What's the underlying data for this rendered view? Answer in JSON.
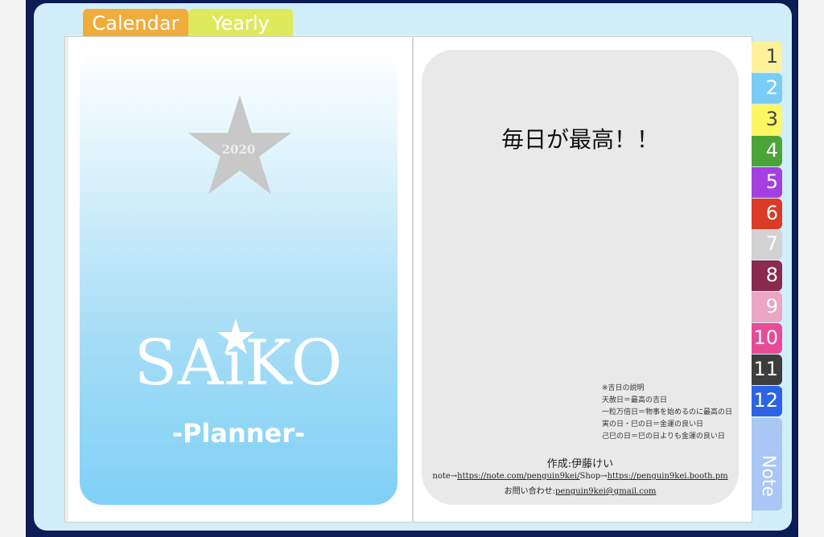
{
  "top_tabs": {
    "calendar": "Calendar",
    "yearly": "Yearly"
  },
  "cover": {
    "year": "2020",
    "logo": "SAiKO",
    "subtitle": "-Planner-"
  },
  "info": {
    "headline": "毎日が最高！！",
    "notes": [
      "※吉日の説明",
      "天赦日＝最高の吉日",
      "一粒万倍日＝物事を始めるのに最高の日",
      "寅の日・巳の日＝金運の良い日",
      "己巳の日＝巳の日よりも金運の良い日"
    ],
    "author": "作成:伊藤けい",
    "note_prefix": "note→",
    "note_url": "https://note.com/penguin9kei/",
    "shop_prefix": "Shop→",
    "shop_url": "https://penguin9kei.booth.pm",
    "contact_prefix": "お問い合わせ:",
    "contact_email": "penguin9kei@gmail.com"
  },
  "month_tabs": [
    {
      "label": "1",
      "color": "#fdf29a",
      "text": "#444"
    },
    {
      "label": "2",
      "color": "#79cdf5",
      "text": "#fff"
    },
    {
      "label": "3",
      "color": "#fdf764",
      "text": "#444"
    },
    {
      "label": "4",
      "color": "#4aa437",
      "text": "#fff"
    },
    {
      "label": "5",
      "color": "#a440e0",
      "text": "#fff"
    },
    {
      "label": "6",
      "color": "#da3a26",
      "text": "#fff"
    },
    {
      "label": "7",
      "color": "#d2d2d2",
      "text": "#fff"
    },
    {
      "label": "8",
      "color": "#8a2a4c",
      "text": "#fff"
    },
    {
      "label": "9",
      "color": "#eaa6c2",
      "text": "#fff"
    },
    {
      "label": "10",
      "color": "#e64b98",
      "text": "#fff"
    },
    {
      "label": "11",
      "color": "#3d3d3d",
      "text": "#fff"
    },
    {
      "label": "12",
      "color": "#2c63e6",
      "text": "#fff"
    }
  ],
  "note_tab": "Note"
}
